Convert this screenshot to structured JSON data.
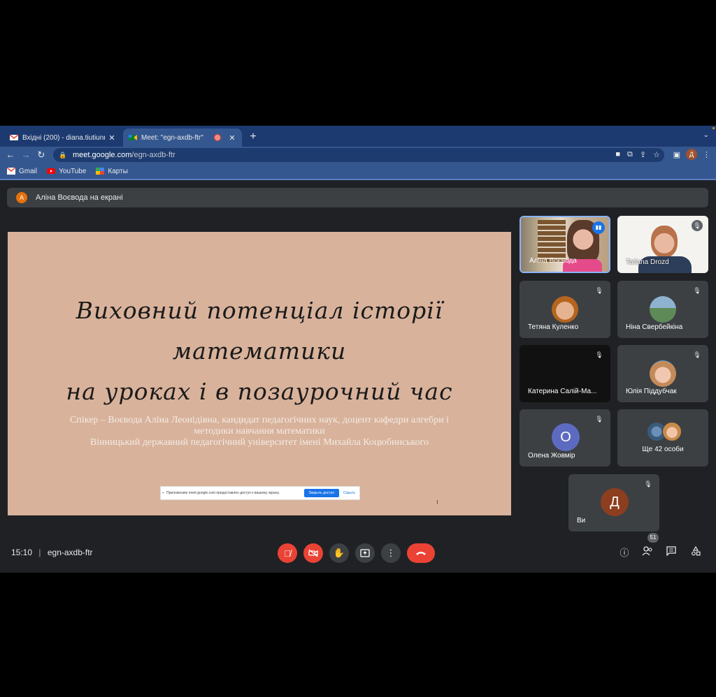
{
  "browser": {
    "tabs": [
      {
        "title": "Вхідні (200) - diana.tiutiunnyk",
        "active": false
      },
      {
        "title": "Meet: \"egn-axdb-ftr\"",
        "active": true
      }
    ],
    "new_tab": "+",
    "url_host": "meet.google.com",
    "url_path": "/egn-axdb-ftr",
    "profile_letter": "Д",
    "bookmarks": [
      "Gmail",
      "YouTube",
      "Карты"
    ]
  },
  "meet": {
    "presenter_initial": "А",
    "presenter_text": "Аліна Воєвода на екрані",
    "slide": {
      "title_line1": "Виховний потенціал історії математики",
      "title_line2": "на уроках і в позаурочний час",
      "subtitle_line1": "Спікер – Воєвода Аліна Леонідівна, кандидат педагогічних наук, доцент кафедри алгебри і",
      "subtitle_line2": "методики навчання математики",
      "subtitle_line3": "Вінницький державний педагогічний університет імені Михайла Коцюбинського",
      "share_message": "Приложению meet.google.com предоставлен доступ к вашему экрану.",
      "share_stop": "Закрыть доступ",
      "share_hide": "Скрыть"
    },
    "participants": [
      {
        "name": "Аліна Воєвода"
      },
      {
        "name": "Tatiana Drozd"
      },
      {
        "name": "Тетяна Куленко"
      },
      {
        "name": "Ніна Свербейкіна"
      },
      {
        "name": "Катерина Салій-Ма..."
      },
      {
        "name": "Юлія Піддубчак"
      },
      {
        "name": "Олена Жовмір",
        "letter": "О",
        "color": "#5c6bc0"
      },
      {
        "name": "Ще 42 особи"
      },
      {
        "name": "Ви",
        "letter": "Д",
        "color": "#8d3e1f"
      }
    ],
    "time": "15:10",
    "meeting_code": "egn-axdb-ftr",
    "people_count": "51"
  }
}
